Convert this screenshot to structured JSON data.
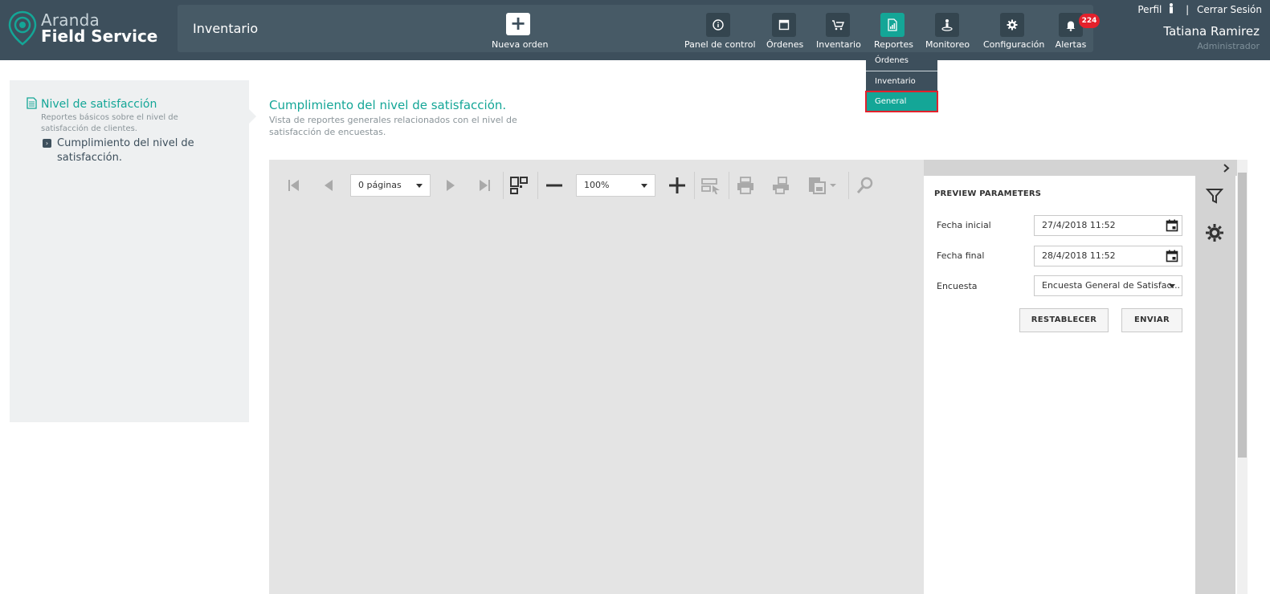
{
  "app": {
    "logo_line1": "Aranda",
    "logo_line2": "Field Service",
    "page_name": "Inventario"
  },
  "header": {
    "new_order_label": "Nueva orden",
    "nav": [
      {
        "label": "Panel de control",
        "icon": "info-icon"
      },
      {
        "label": "Órdenes",
        "icon": "window-icon"
      },
      {
        "label": "Inventario",
        "icon": "cart-icon"
      },
      {
        "label": "Reportes",
        "icon": "report-icon",
        "active": true
      },
      {
        "label": "Monitoreo",
        "icon": "person-pin-icon"
      },
      {
        "label": "Configuración",
        "icon": "gear-icon"
      },
      {
        "label": "Alertas",
        "icon": "bell-icon"
      }
    ],
    "alerts_badge": "224",
    "profile_label": "Perfil",
    "separator": "|",
    "logout_label": "Cerrar Sesión",
    "user_name": "Tatiana Ramirez",
    "user_role": "Administrador"
  },
  "reports_menu": {
    "items": [
      "Órdenes",
      "Inventario",
      "General"
    ],
    "active": "General"
  },
  "sidebar": {
    "title": "Nivel de satisfacción",
    "description": "Reportes básicos sobre el nivel de satisfacción de clientes.",
    "sub_item": "Cumplimiento del nivel de satisfacción."
  },
  "main": {
    "title": "Cumplimiento del nivel de satisfacción.",
    "description": "Vista de reportes generales relacionados con el nivel de satisfacción de encuestas."
  },
  "viewer": {
    "pages_select": "0 páginas",
    "zoom_select": "100%"
  },
  "parameters": {
    "title": "PREVIEW PARAMETERS",
    "start_label": "Fecha inicial",
    "start_value": "27/4/2018 11:52",
    "end_label": "Fecha final",
    "end_value": "28/4/2018 11:52",
    "survey_label": "Encuesta",
    "survey_value": "Encuesta General de Satisfac...",
    "reset_label": "RESTABLECER",
    "submit_label": "ENVIAR"
  },
  "colors": {
    "header": "#3d4f5c",
    "accent": "#14a697",
    "badge": "#e3212c",
    "viewer_bg": "#e4e4e4"
  }
}
